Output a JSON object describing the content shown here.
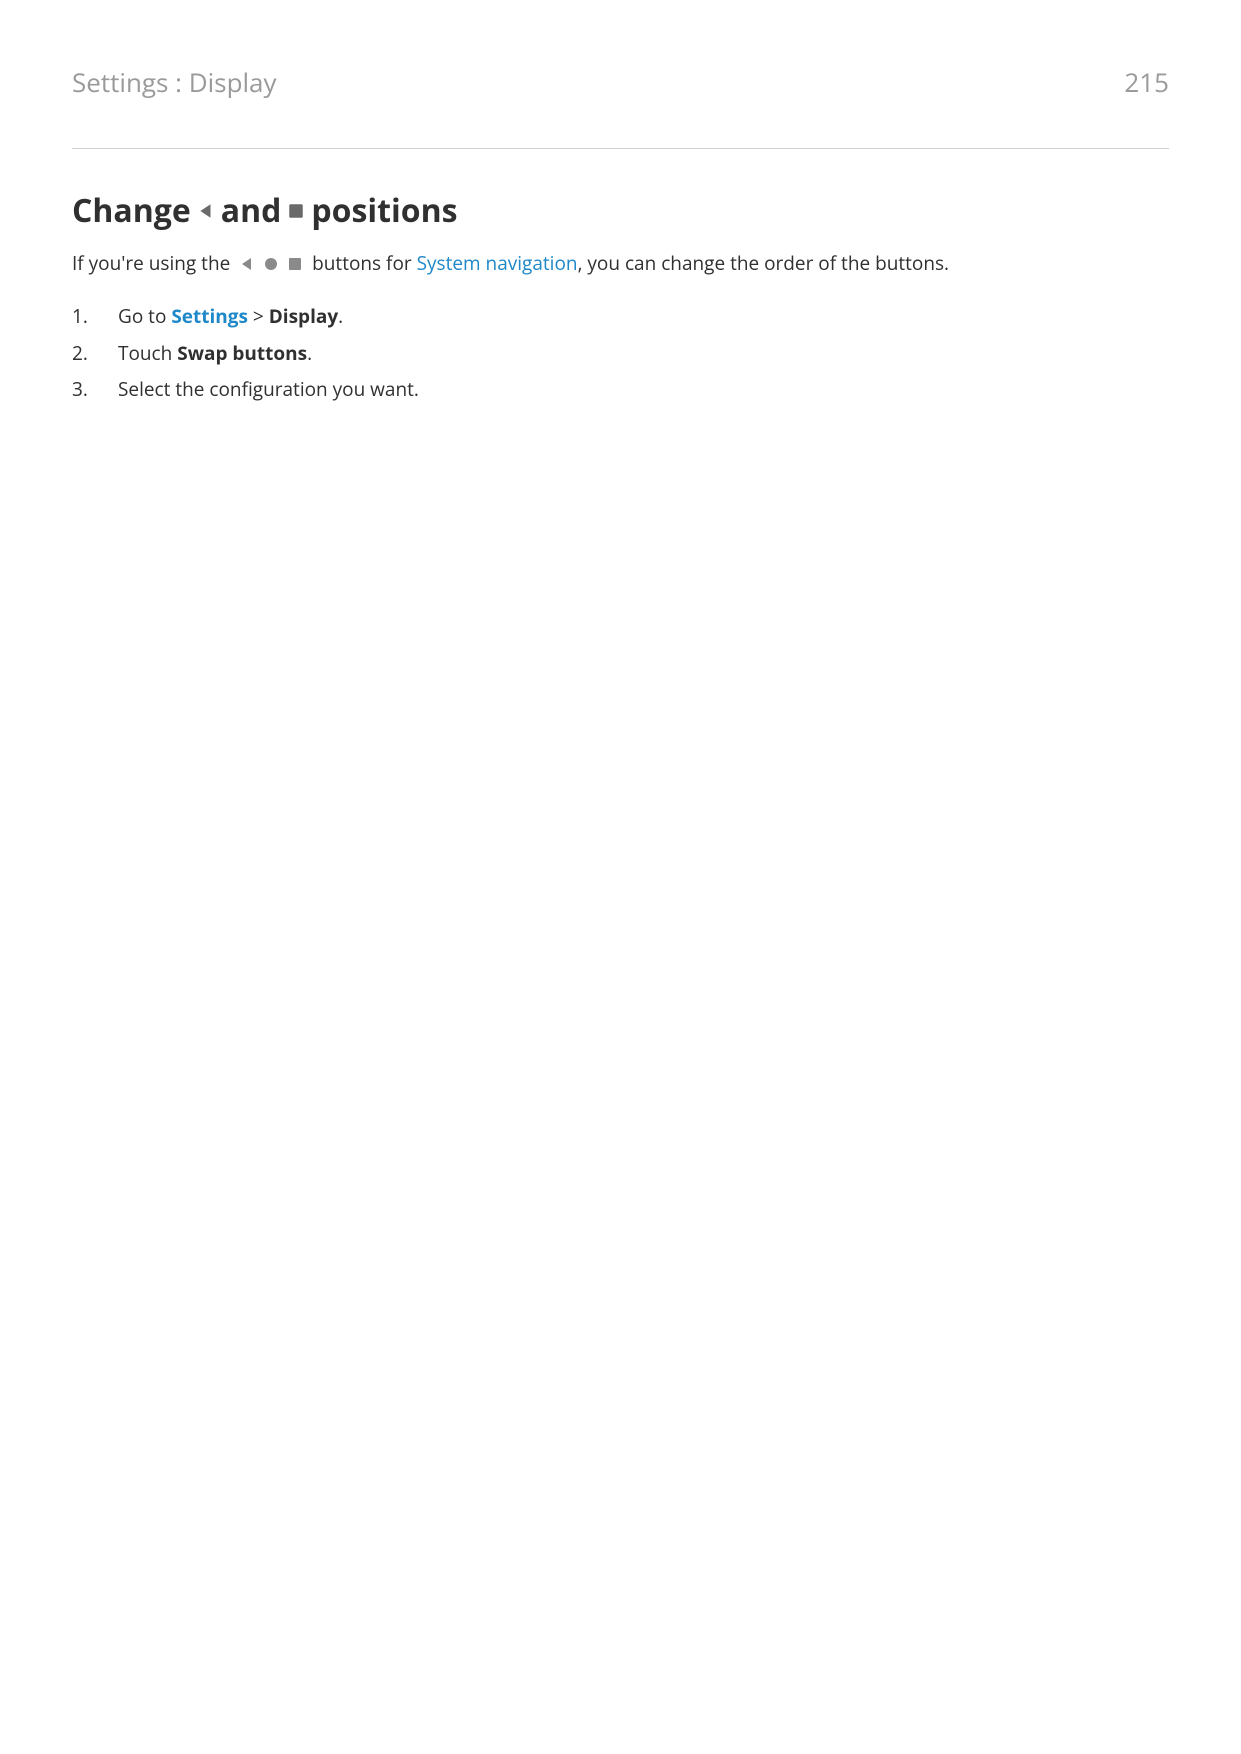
{
  "header": {
    "breadcrumb": "Settings : Display",
    "page_number": "215"
  },
  "heading": {
    "part1": "Change",
    "part2": "and",
    "part3": "positions"
  },
  "intro": {
    "part1": "If you're using the",
    "part2": "buttons for ",
    "link": "System navigation",
    "part3": ", you can change the order of the buttons."
  },
  "steps": [
    {
      "prefix": "Go to ",
      "link": "Settings",
      "separator": " > ",
      "bold": "Display",
      "suffix": "."
    },
    {
      "prefix": "Touch ",
      "bold": "Swap buttons",
      "suffix": "."
    },
    {
      "prefix": "Select the configuration you want."
    }
  ]
}
